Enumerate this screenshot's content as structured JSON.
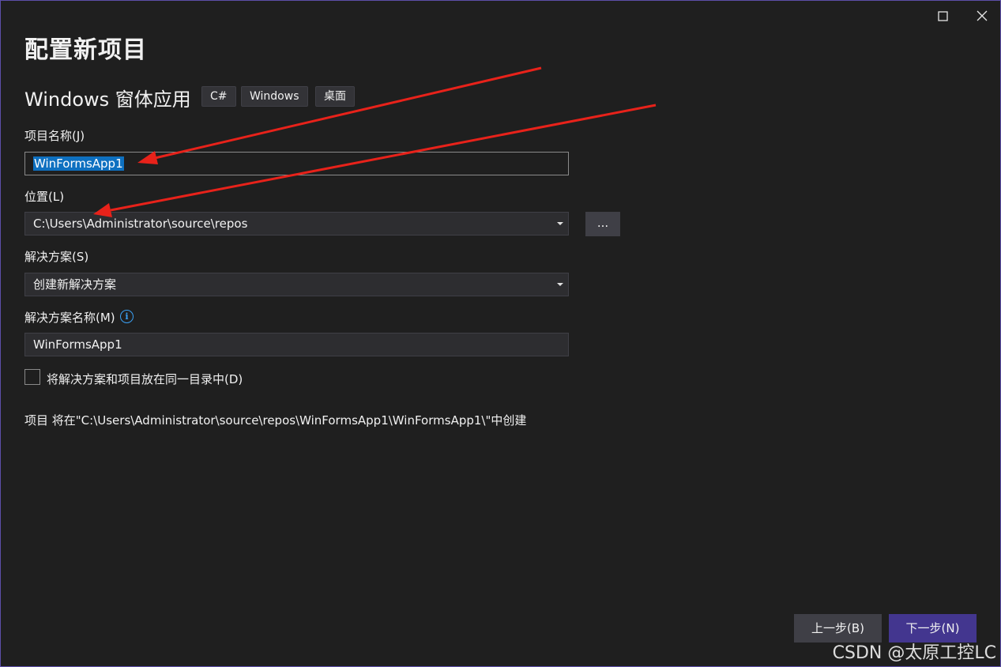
{
  "window": {
    "maximize_icon": "maximize-icon",
    "close_icon": "close-icon"
  },
  "title": "配置新项目",
  "template": {
    "name": "Windows 窗体应用",
    "tags": [
      "C#",
      "Windows",
      "桌面"
    ]
  },
  "project_name": {
    "label": "项目名称(J)",
    "value": "WinFormsApp1"
  },
  "location": {
    "label": "位置(L)",
    "value": "C:\\Users\\Administrator\\source\\repos",
    "browse_label": "..."
  },
  "solution": {
    "label": "解决方案(S)",
    "value": "创建新解决方案"
  },
  "solution_name": {
    "label": "解决方案名称(M)",
    "value": "WinFormsApp1",
    "info_icon": "info-icon"
  },
  "same_dir": {
    "label": "将解决方案和项目放在同一目录中(D)",
    "checked": false
  },
  "summary": "项目 将在\"C:\\Users\\Administrator\\source\\repos\\WinFormsApp1\\WinFormsApp1\\\"中创建",
  "buttons": {
    "back": "上一步(B)",
    "next": "下一步(N)"
  },
  "watermark": "CSDN @太原工控LC",
  "colors": {
    "background": "#1f1f1f",
    "accent": "#43368f",
    "selection": "#0e70c0",
    "annotation_arrow": "#e8221a"
  }
}
